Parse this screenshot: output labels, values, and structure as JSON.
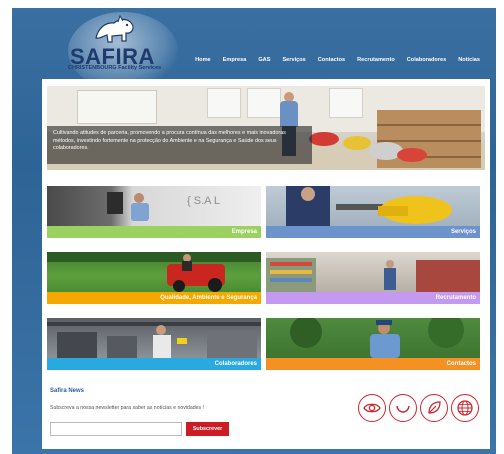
{
  "brand": {
    "name": "SAFIRA",
    "tagline": "CHRISTENBOURG Facility Services"
  },
  "nav": {
    "items": [
      "Home",
      "Empresa",
      "GAS",
      "Serviços",
      "Contactos",
      "Recrutamento",
      "Colaboradores",
      "Notícias"
    ]
  },
  "hero": {
    "caption": "Cultivando atitudes de parceria, promovendo a procura contínua das melhores e mais inovadoras métodos, investindo fortemente na protecção do Ambiente e na Segurança e Saúde dos seus colaboradores."
  },
  "tiles": [
    {
      "label": "Empresa",
      "color": "#9bd160"
    },
    {
      "label": "Serviços",
      "color": "#6d93cd"
    },
    {
      "label": "Qualidade, Ambiente e Segurança",
      "color": "#f5a800"
    },
    {
      "label": "Recrutamento",
      "color": "#c39af0"
    },
    {
      "label": "Colaboradores",
      "color": "#2aa8e0"
    },
    {
      "label": "Contactos",
      "color": "#f59122"
    }
  ],
  "newsletter": {
    "title": "Safira News",
    "description": "Subscreva a nossa newsletter para saber as notícias e novidades !",
    "input_value": "",
    "button_label": "Subscrever"
  },
  "footer_icons": [
    "eye-icon",
    "smile-icon",
    "leaf-icon",
    "globe-icon"
  ],
  "colors": {
    "header_blue": "#2d6496",
    "logo_navy": "#1e3a6e",
    "accent_red": "#cc1d25",
    "news_title_blue": "#2b5f9a"
  }
}
